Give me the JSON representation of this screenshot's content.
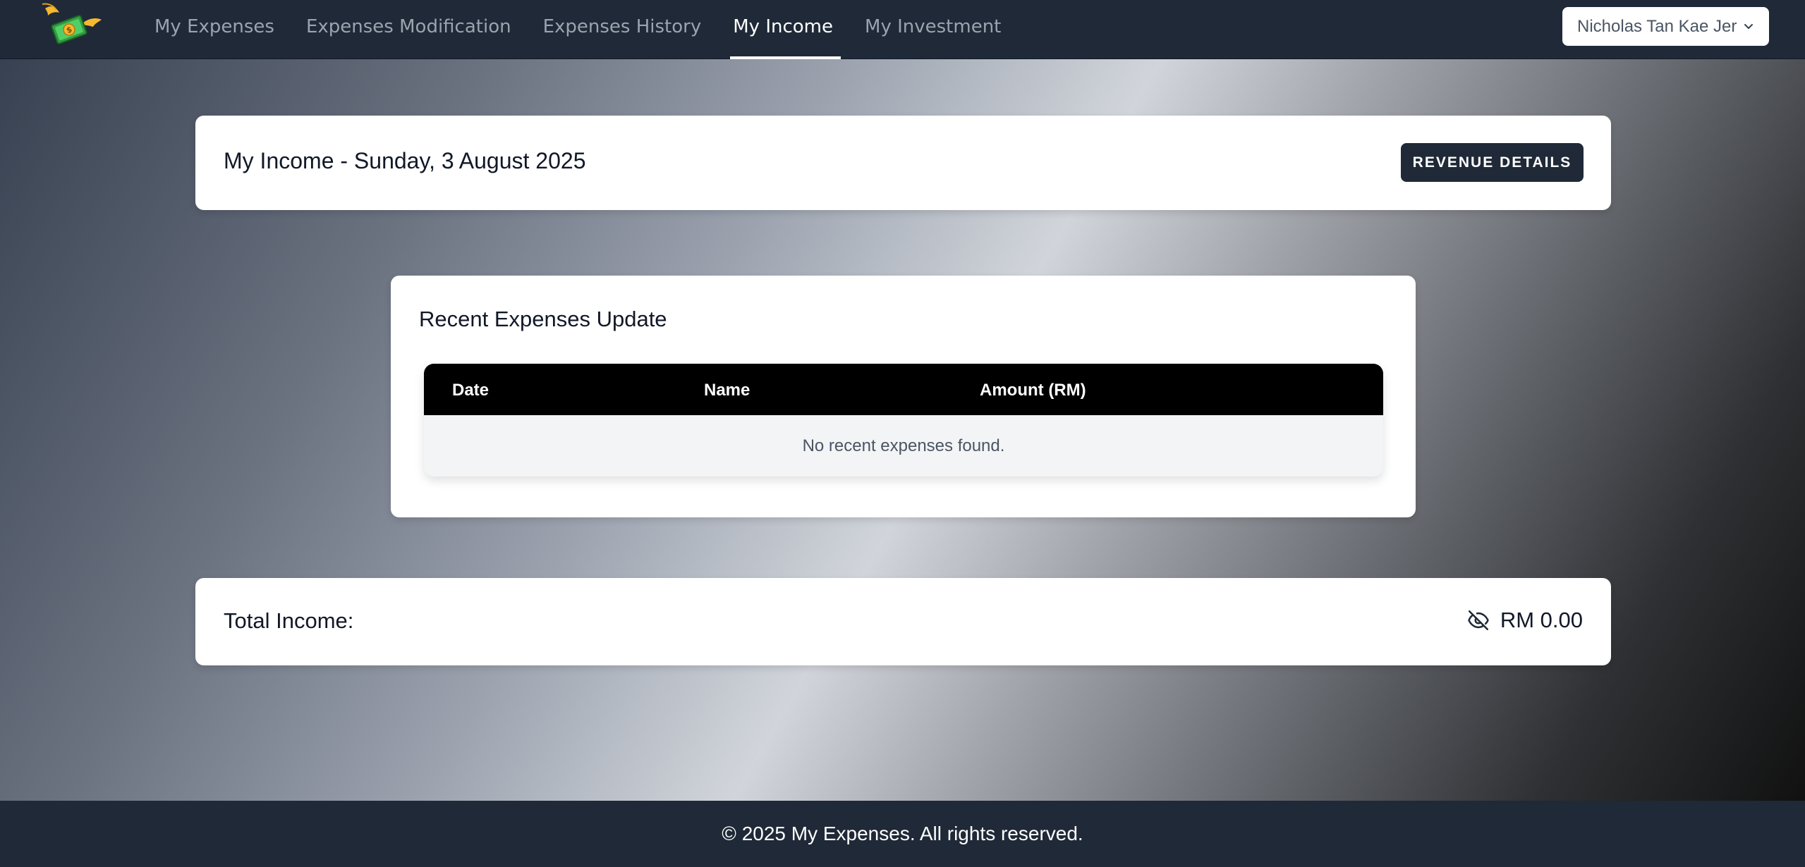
{
  "navbar": {
    "logo_icon": "flying-money-icon",
    "links": [
      {
        "label": "My Expenses",
        "active": false
      },
      {
        "label": "Expenses Modification",
        "active": false
      },
      {
        "label": "Expenses History",
        "active": false
      },
      {
        "label": "My Income",
        "active": true
      },
      {
        "label": "My Investment",
        "active": false
      }
    ],
    "user_name": "Nicholas Tan Kae Jer",
    "user_menu_icon": "chevron-down-icon"
  },
  "header": {
    "title": "My Income - Sunday, 3 August 2025",
    "revenue_button": "REVENUE DETAILS"
  },
  "recent": {
    "title": "Recent Expenses Update",
    "columns": [
      "Date",
      "Name",
      "Amount (RM)"
    ],
    "rows": [],
    "empty_message": "No recent expenses found."
  },
  "total": {
    "label": "Total Income:",
    "value": "RM 0.00",
    "visibility_icon": "eye-off-icon"
  },
  "footer": {
    "text": "© 2025 My Expenses. All rights reserved."
  },
  "colors": {
    "navbar_bg": "#1f2937",
    "button_bg": "#1f2937",
    "table_header_bg": "#000000",
    "card_bg": "#ffffff"
  }
}
